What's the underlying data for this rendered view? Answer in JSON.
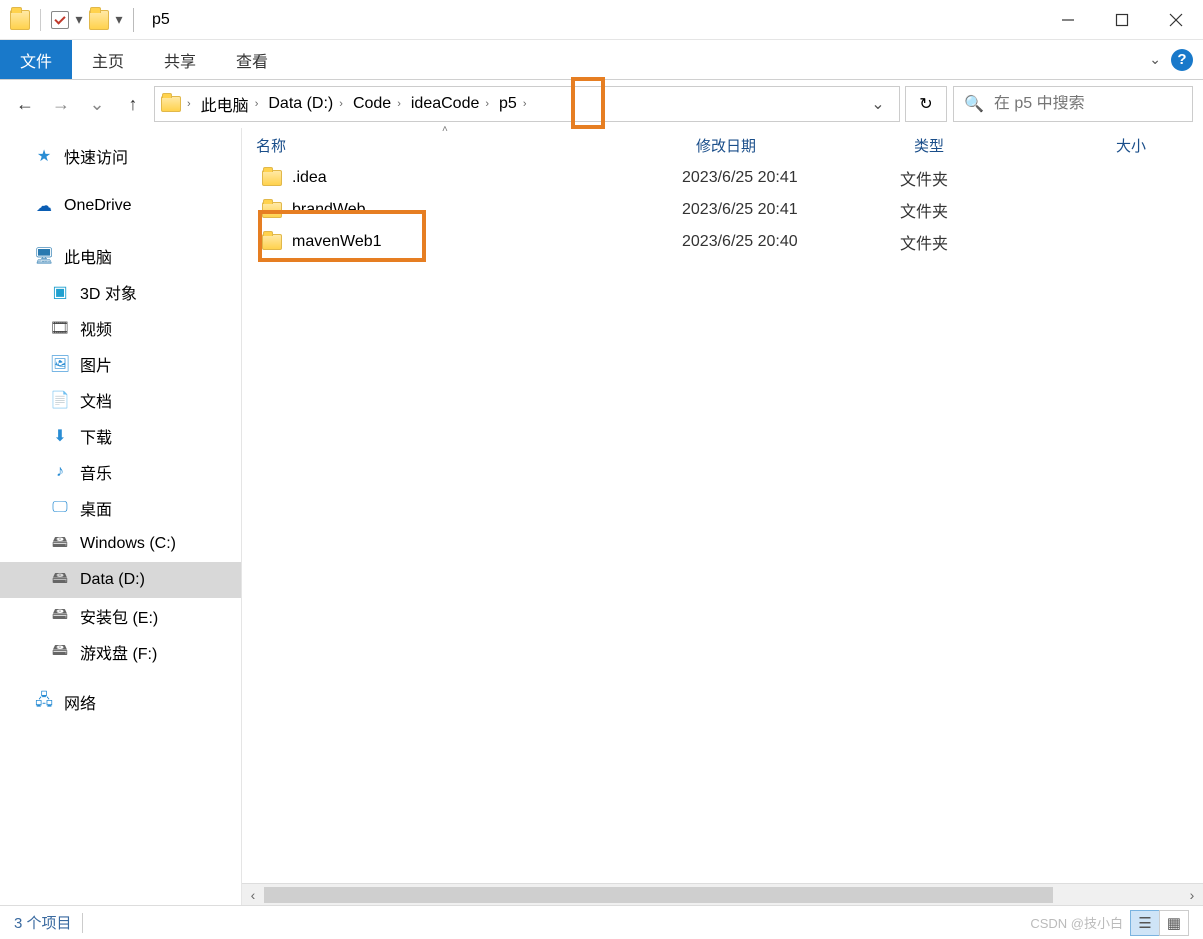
{
  "window": {
    "title": "p5"
  },
  "ribbon": {
    "file": "文件",
    "tabs": [
      "主页",
      "共享",
      "查看"
    ]
  },
  "nav": {
    "breadcrumb": [
      "此电脑",
      "Data (D:)",
      "Code",
      "ideaCode",
      "p5"
    ]
  },
  "search": {
    "placeholder": "在 p5 中搜索"
  },
  "sidebar": {
    "quick_access": "快速访问",
    "onedrive": "OneDrive",
    "this_pc": "此电脑",
    "items": [
      {
        "label": "3D 对象"
      },
      {
        "label": "视频"
      },
      {
        "label": "图片"
      },
      {
        "label": "文档"
      },
      {
        "label": "下载"
      },
      {
        "label": "音乐"
      },
      {
        "label": "桌面"
      },
      {
        "label": "Windows (C:)"
      },
      {
        "label": "Data (D:)"
      },
      {
        "label": "安装包 (E:)"
      },
      {
        "label": "游戏盘 (F:)"
      }
    ],
    "network": "网络"
  },
  "columns": {
    "name": "名称",
    "date": "修改日期",
    "type": "类型",
    "size": "大小"
  },
  "rows": [
    {
      "name": ".idea",
      "date": "2023/6/25 20:41",
      "type": "文件夹"
    },
    {
      "name": "brandWeb",
      "date": "2023/6/25 20:41",
      "type": "文件夹"
    },
    {
      "name": "mavenWeb1",
      "date": "2023/6/25 20:40",
      "type": "文件夹"
    }
  ],
  "status": {
    "items": "3 个项目"
  },
  "watermark": "CSDN @技小白"
}
